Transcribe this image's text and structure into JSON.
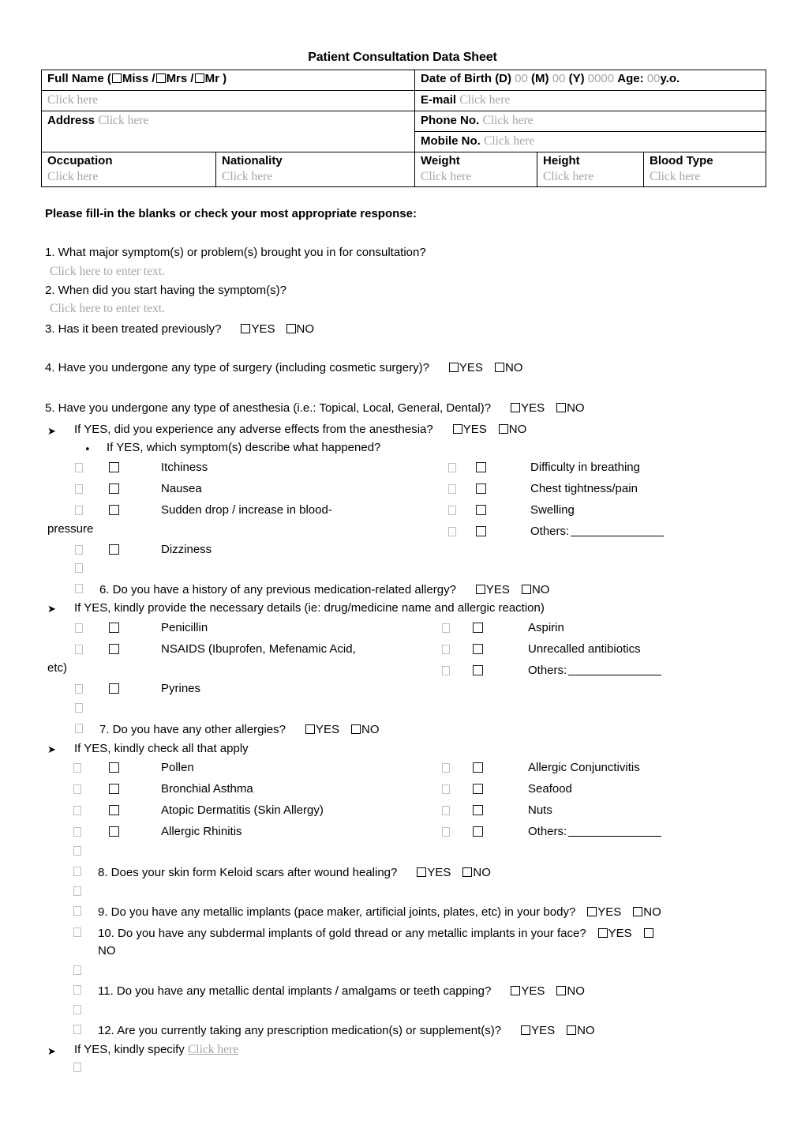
{
  "document": {
    "title": "Patient Consultation Data Sheet"
  },
  "header_table": {
    "full_name": {
      "label_prefix": "Full Name (",
      "options": [
        "Miss",
        "Mrs",
        "Mr"
      ],
      "sep": "/",
      "label_suffix": ")",
      "value_placeholder": "Click here"
    },
    "date_of_birth": {
      "label": "Date of Birth",
      "d_label": "(D)",
      "d_value": "00",
      "m_label": "(M)",
      "m_value": "00",
      "y_label": "(Y)",
      "y_value": "0000",
      "age_label": "Age:",
      "age_value": "00",
      "age_unit": "y.o."
    },
    "email": {
      "label": "E-mail",
      "value_placeholder": "Click here"
    },
    "address": {
      "label": "Address",
      "value_placeholder": "Click here"
    },
    "phone": {
      "label": "Phone No.",
      "value_placeholder": "Click here"
    },
    "mobile": {
      "label": "Mobile No.",
      "value_placeholder": "Click here"
    },
    "occupation": {
      "label": "Occupation",
      "value_placeholder": "Click here"
    },
    "nationality": {
      "label": "Nationality",
      "value_placeholder": "Click here"
    },
    "weight": {
      "label": "Weight",
      "value_placeholder": "Click here"
    },
    "height": {
      "label": "Height",
      "value_placeholder": "Click here"
    },
    "blood_type": {
      "label": "Blood Type",
      "value_placeholder": "Click here"
    }
  },
  "instruction": "Please fill-in the blanks or check your most appropriate response:",
  "labels": {
    "yes": "YES",
    "no": "NO",
    "enter_text": "Click here to enter text.",
    "click_here": "Click here",
    "others": "Others:"
  },
  "questions": {
    "q1": "1. What major symptom(s) or problem(s) brought you in for consultation?",
    "q2": "2. When did you start having the symptom(s)?",
    "q3": "3. Has it been treated previously?",
    "q4": "4. Have you undergone any type of surgery (including cosmetic surgery)?",
    "q5": "5. Have you undergone any type of anesthesia (i.e.: Topical, Local, General, Dental)?",
    "q5a": "If YES, did you experience any adverse effects from the anesthesia?",
    "q5b": "If YES, which symptom(s) describe what happened?",
    "q6": "6. Do you have a history of any previous medication-related allergy?",
    "q6a": "If YES, kindly provide the necessary details (ie: drug/medicine name and allergic reaction)",
    "q7": "7. Do you have any other allergies?",
    "q7a": "If YES, kindly check all that apply",
    "q8": "8. Does your skin form Keloid scars after wound healing?",
    "q9": "9. Do you have any metallic implants (pace maker, artificial joints, plates, etc) in your body?",
    "q10_line1": "10. Do you have any subdermal implants of gold thread or any metallic implants in your face?",
    "q10_line2": "NO",
    "q11": "11. Do you have any metallic dental implants / amalgams or teeth capping?",
    "q12": "12. Are you currently taking any prescription medication(s) or supplement(s)?",
    "q12a": "If YES, kindly specify"
  },
  "anesthesia_symptoms": {
    "left": [
      "Itchiness",
      "Nausea",
      "Sudden drop / increase in blood-",
      "Dizziness"
    ],
    "left_wrap": "pressure",
    "right": [
      "Difficulty in breathing",
      "Chest tightness/pain",
      "Swelling",
      "Others:"
    ]
  },
  "medication_allergies": {
    "left": [
      "Penicillin",
      "NSAIDS (Ibuprofen, Mefenamic Acid,",
      "Pyrines"
    ],
    "left_wrap": "etc)",
    "right": [
      "Aspirin",
      "Unrecalled antibiotics",
      "Others:"
    ]
  },
  "other_allergies": {
    "left": [
      "Pollen",
      "Bronchial Asthma",
      "Atopic Dermatitis (Skin Allergy)",
      "Allergic Rhinitis"
    ],
    "right": [
      "Allergic Conjunctivitis",
      "Seafood",
      "Nuts",
      "Others:"
    ]
  },
  "markers": {
    "arrow": "➤",
    "bullet": "•"
  }
}
